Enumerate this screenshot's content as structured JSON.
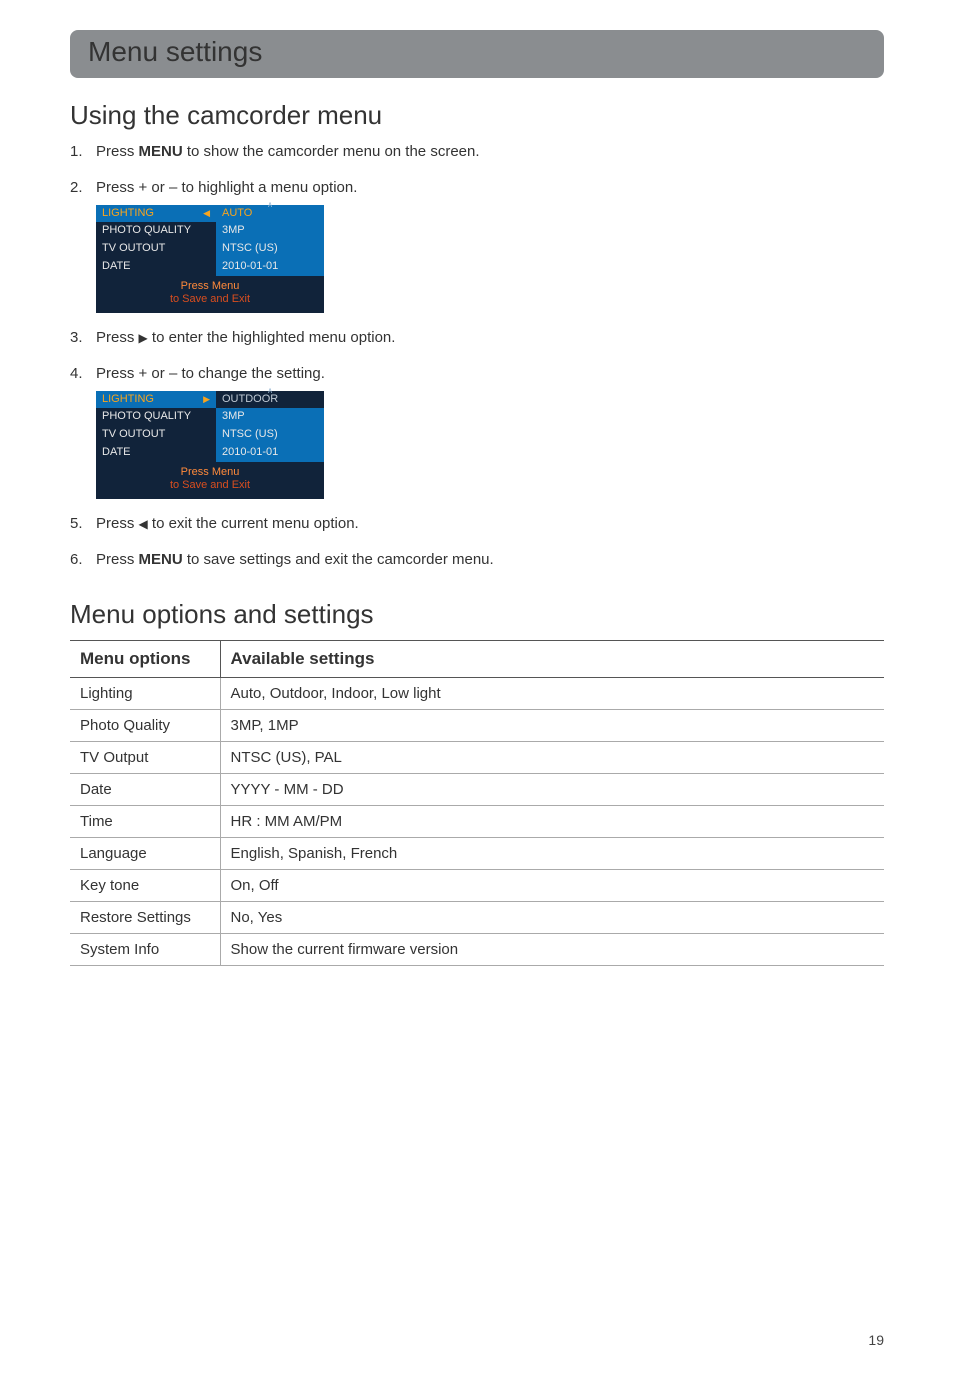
{
  "banner": {
    "title": "Menu settings"
  },
  "section1": {
    "heading": "Using the camcorder menu",
    "steps": {
      "s1a": "Press ",
      "s1b": "MENU",
      "s1c": " to show the camcorder menu on the screen.",
      "s2": "Press + or – to highlight a menu option.",
      "s3a": "Press ",
      "s3b": " to enter the highlighted menu option.",
      "s4": "Press + or – to change the setting.",
      "s5a": "Press ",
      "s5b": " to exit the current menu option.",
      "s6a": "Press ",
      "s6b": "MENU",
      "s6c": " to save settings and exit the camcorder menu."
    }
  },
  "shot1": {
    "rows": [
      {
        "left": "LIGHTING",
        "leftHL": true,
        "arrow": "left",
        "right": "AUTO",
        "rightHL": true,
        "caret": "∧"
      },
      {
        "left": "PHOTO QUALITY",
        "right": "3MP"
      },
      {
        "left": "TV OUTOUT",
        "right": "NTSC (US)"
      },
      {
        "left": "DATE",
        "right": "2010-01-01"
      }
    ],
    "footer1": "Press Menu",
    "footer2": "to Save and Exit"
  },
  "shot2": {
    "rows": [
      {
        "left": "LIGHTING",
        "leftHL": true,
        "arrow": "right",
        "right": "OUTDOOR",
        "rightHL": true,
        "caret": "∧",
        "rightDark": true
      },
      {
        "left": "PHOTO QUALITY",
        "right": "3MP"
      },
      {
        "left": "TV OUTOUT",
        "right": "NTSC (US)"
      },
      {
        "left": "DATE",
        "right": "2010-01-01"
      }
    ],
    "footer1": "Press Menu",
    "footer2": "to Save and Exit"
  },
  "section2": {
    "heading": "Menu options and settings",
    "headers": {
      "c1": "Menu options",
      "c2": "Available settings"
    },
    "rows": [
      {
        "opt": "Lighting",
        "val": "Auto, Outdoor, Indoor, Low light"
      },
      {
        "opt": "Photo Quality",
        "val": "3MP, 1MP"
      },
      {
        "opt": "TV Output",
        "val": "NTSC (US), PAL"
      },
      {
        "opt": "Date",
        "val": "YYYY - MM - DD"
      },
      {
        "opt": "Time",
        "val": "HR : MM AM/PM"
      },
      {
        "opt": "Language",
        "val": "English, Spanish, French"
      },
      {
        "opt": "Key tone",
        "val": "On, Off"
      },
      {
        "opt": "Restore Settings",
        "val": "No, Yes"
      },
      {
        "opt": "System Info",
        "val": "Show the current firmware version"
      }
    ]
  },
  "pageNumber": "19"
}
